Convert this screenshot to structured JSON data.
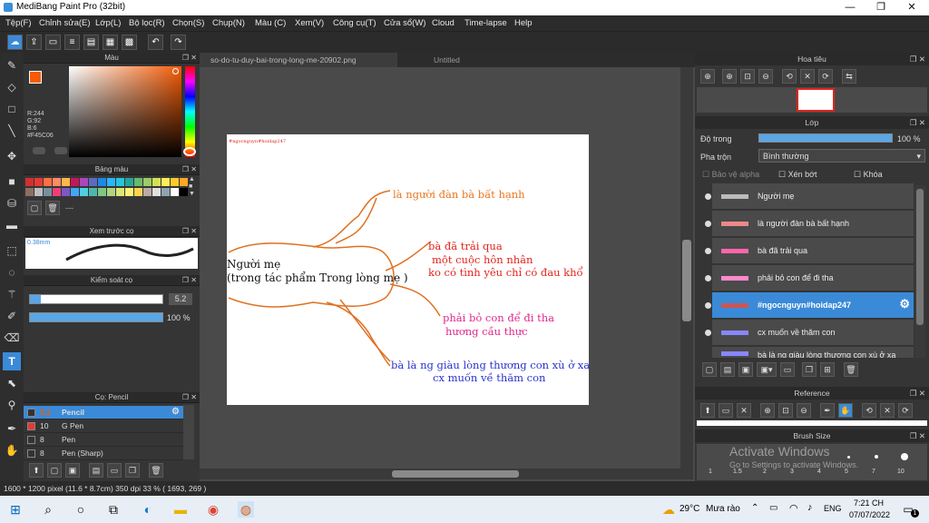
{
  "window": {
    "title": "MediBang Paint Pro (32bit)",
    "min": "—",
    "max": "❐",
    "close": "✕"
  },
  "menu": [
    "Tệp(F)",
    "Chỉnh sửa(E)",
    "Lớp(L)",
    "Bộ lọc(R)",
    "Chọn(S)",
    "Chụp(N)",
    "Màu (C)",
    "Xem(V)",
    "Công cụ(T)",
    "Cửa sổ(W)",
    "Cloud",
    "Time-lapse",
    "Help"
  ],
  "tabs": [
    "so-do-tu-duy-bai-trong-long-me-20902.png",
    "Untitled"
  ],
  "color_panel": {
    "title": "Màu",
    "r": "R:244",
    "g": "G:92",
    "b": "B:6",
    "hex": "#F45C06",
    "fg": "#F45C06",
    "bg": "#ffffff"
  },
  "palette_panel": {
    "title": "Bảng màu",
    "colors": [
      "#d32f2f",
      "#e53935",
      "#ff7043",
      "#ff8a65",
      "#ffb74d",
      "#c2185b",
      "#ab47bc",
      "#5c6bc0",
      "#1e88e5",
      "#29b6f6",
      "#26c6da",
      "#26a69a",
      "#66bb6a",
      "#9ccc65",
      "#d4e157",
      "#ffee58",
      "#ffca28",
      "#ffa726",
      "#8d6e63",
      "#bdbdbd",
      "#78909c",
      "#ec407a",
      "#7e57c2",
      "#42a5f5",
      "#4dd0e1",
      "#4db6ac",
      "#81c784",
      "#aed581",
      "#dce775",
      "#fff176",
      "#ffd54f",
      "#bcaaa4",
      "#e0e0e0",
      "#90a4ae",
      "#ffffff",
      "#000000"
    ]
  },
  "brush_preview": {
    "title": "Xem trước cọ",
    "size": "0.38mm"
  },
  "brush_control": {
    "title": "Kiểm soát cọ",
    "size": "5.2",
    "opacity": "100 %",
    "opacity_value": 1.0
  },
  "brush_list": {
    "title": "Cọ: Pencil",
    "items": [
      {
        "size": "5.2",
        "name": "Pencil",
        "color": "#333333",
        "selected": true
      },
      {
        "size": "10",
        "name": "G Pen",
        "color": "#e53935",
        "selected": false
      },
      {
        "size": "8",
        "name": "Pen",
        "color": "#333333",
        "selected": false
      },
      {
        "size": "8",
        "name": "Pen (Sharp)",
        "color": "#333333",
        "selected": false
      }
    ]
  },
  "navigator": {
    "title": "Hoa tiêu"
  },
  "layer_panel": {
    "title": "Lớp",
    "opacity_label": "Độ trong",
    "opacity_value": "100 %",
    "blend_label": "Pha trộn",
    "blend_value": "Bình thường",
    "protect_alpha": "Bảo vệ alpha",
    "clip": "Xén bớt",
    "lock": "Khóa",
    "layers": [
      {
        "name": "Người mẹ",
        "thumb": "#bbbbbb",
        "selected": false
      },
      {
        "name": "là người đàn bà bất hạnh",
        "thumb": "#e88",
        "selected": false
      },
      {
        "name": "bà đã trải qua",
        "thumb": "#f6a",
        "selected": false
      },
      {
        "name": "phải bỏ con để đi tha",
        "thumb": "#f8c",
        "selected": false
      },
      {
        "name": "#ngocnguyn#hoidap247",
        "thumb": "#c55",
        "selected": true
      },
      {
        "name": "cx muốn về thăm con",
        "thumb": "#88f",
        "selected": false
      },
      {
        "name": "bà là ng giàu lòng thương con xù ở xa",
        "thumb": "#88f",
        "selected": false
      }
    ]
  },
  "reference": {
    "title": "Reference"
  },
  "brush_size": {
    "title": "Brush Size",
    "sizes": [
      "1",
      "1.5",
      "2",
      "3",
      "4",
      "5",
      "7",
      "10"
    ]
  },
  "watermark": {
    "line1": "Activate Windows",
    "line2": "Go to Settings to activate Windows."
  },
  "mindmap": {
    "tiny_label": "#ngocnguyn#hoidap247",
    "center_line1": "Người mẹ",
    "center_line2": "(trong tác phẩm Trong lòng mẹ )",
    "b1": "là người đàn bà bất hạnh",
    "b2_l1": "bà đã trải qua",
    "b2_l2": "một cuộc hôn nhân",
    "b2_l3": "ko có tình yêu chỉ có đau khổ",
    "b3_l1": "phải bỏ con để đi tha",
    "b3_l2": "hương cầu thực",
    "b4_l1": "bà là ng giàu lòng thương con xù ở xa",
    "b4_l2": "cx muốn về thăm con",
    "colors": {
      "branch": "#e07020",
      "orange": "#e8761e",
      "red": "#e0241c",
      "pink": "#e0288c",
      "blue": "#2b33cc"
    }
  },
  "status": "1600 * 1200 pixel   (11.6 * 8.7cm)   350 dpi   33 %   ( 1693, 269 )",
  "taskbar": {
    "weather_temp": "29°C",
    "weather_text": "Mưa rào",
    "time": "7:21 CH",
    "date": "07/07/2022",
    "lang": "ENG",
    "badge": "1"
  }
}
